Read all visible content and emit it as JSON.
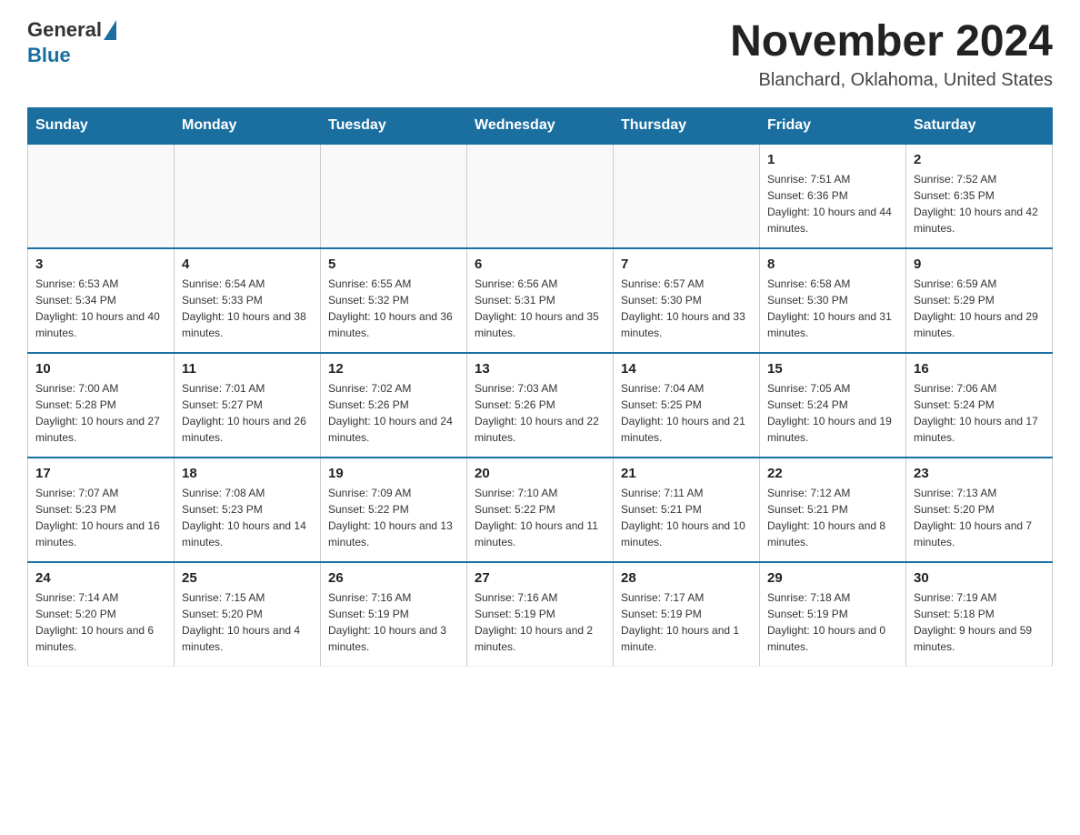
{
  "header": {
    "logo_general": "General",
    "logo_blue": "Blue",
    "title": "November 2024",
    "subtitle": "Blanchard, Oklahoma, United States"
  },
  "weekdays": [
    "Sunday",
    "Monday",
    "Tuesday",
    "Wednesday",
    "Thursday",
    "Friday",
    "Saturday"
  ],
  "weeks": [
    [
      {
        "day": "",
        "info": ""
      },
      {
        "day": "",
        "info": ""
      },
      {
        "day": "",
        "info": ""
      },
      {
        "day": "",
        "info": ""
      },
      {
        "day": "",
        "info": ""
      },
      {
        "day": "1",
        "info": "Sunrise: 7:51 AM\nSunset: 6:36 PM\nDaylight: 10 hours and 44 minutes."
      },
      {
        "day": "2",
        "info": "Sunrise: 7:52 AM\nSunset: 6:35 PM\nDaylight: 10 hours and 42 minutes."
      }
    ],
    [
      {
        "day": "3",
        "info": "Sunrise: 6:53 AM\nSunset: 5:34 PM\nDaylight: 10 hours and 40 minutes."
      },
      {
        "day": "4",
        "info": "Sunrise: 6:54 AM\nSunset: 5:33 PM\nDaylight: 10 hours and 38 minutes."
      },
      {
        "day": "5",
        "info": "Sunrise: 6:55 AM\nSunset: 5:32 PM\nDaylight: 10 hours and 36 minutes."
      },
      {
        "day": "6",
        "info": "Sunrise: 6:56 AM\nSunset: 5:31 PM\nDaylight: 10 hours and 35 minutes."
      },
      {
        "day": "7",
        "info": "Sunrise: 6:57 AM\nSunset: 5:30 PM\nDaylight: 10 hours and 33 minutes."
      },
      {
        "day": "8",
        "info": "Sunrise: 6:58 AM\nSunset: 5:30 PM\nDaylight: 10 hours and 31 minutes."
      },
      {
        "day": "9",
        "info": "Sunrise: 6:59 AM\nSunset: 5:29 PM\nDaylight: 10 hours and 29 minutes."
      }
    ],
    [
      {
        "day": "10",
        "info": "Sunrise: 7:00 AM\nSunset: 5:28 PM\nDaylight: 10 hours and 27 minutes."
      },
      {
        "day": "11",
        "info": "Sunrise: 7:01 AM\nSunset: 5:27 PM\nDaylight: 10 hours and 26 minutes."
      },
      {
        "day": "12",
        "info": "Sunrise: 7:02 AM\nSunset: 5:26 PM\nDaylight: 10 hours and 24 minutes."
      },
      {
        "day": "13",
        "info": "Sunrise: 7:03 AM\nSunset: 5:26 PM\nDaylight: 10 hours and 22 minutes."
      },
      {
        "day": "14",
        "info": "Sunrise: 7:04 AM\nSunset: 5:25 PM\nDaylight: 10 hours and 21 minutes."
      },
      {
        "day": "15",
        "info": "Sunrise: 7:05 AM\nSunset: 5:24 PM\nDaylight: 10 hours and 19 minutes."
      },
      {
        "day": "16",
        "info": "Sunrise: 7:06 AM\nSunset: 5:24 PM\nDaylight: 10 hours and 17 minutes."
      }
    ],
    [
      {
        "day": "17",
        "info": "Sunrise: 7:07 AM\nSunset: 5:23 PM\nDaylight: 10 hours and 16 minutes."
      },
      {
        "day": "18",
        "info": "Sunrise: 7:08 AM\nSunset: 5:23 PM\nDaylight: 10 hours and 14 minutes."
      },
      {
        "day": "19",
        "info": "Sunrise: 7:09 AM\nSunset: 5:22 PM\nDaylight: 10 hours and 13 minutes."
      },
      {
        "day": "20",
        "info": "Sunrise: 7:10 AM\nSunset: 5:22 PM\nDaylight: 10 hours and 11 minutes."
      },
      {
        "day": "21",
        "info": "Sunrise: 7:11 AM\nSunset: 5:21 PM\nDaylight: 10 hours and 10 minutes."
      },
      {
        "day": "22",
        "info": "Sunrise: 7:12 AM\nSunset: 5:21 PM\nDaylight: 10 hours and 8 minutes."
      },
      {
        "day": "23",
        "info": "Sunrise: 7:13 AM\nSunset: 5:20 PM\nDaylight: 10 hours and 7 minutes."
      }
    ],
    [
      {
        "day": "24",
        "info": "Sunrise: 7:14 AM\nSunset: 5:20 PM\nDaylight: 10 hours and 6 minutes."
      },
      {
        "day": "25",
        "info": "Sunrise: 7:15 AM\nSunset: 5:20 PM\nDaylight: 10 hours and 4 minutes."
      },
      {
        "day": "26",
        "info": "Sunrise: 7:16 AM\nSunset: 5:19 PM\nDaylight: 10 hours and 3 minutes."
      },
      {
        "day": "27",
        "info": "Sunrise: 7:16 AM\nSunset: 5:19 PM\nDaylight: 10 hours and 2 minutes."
      },
      {
        "day": "28",
        "info": "Sunrise: 7:17 AM\nSunset: 5:19 PM\nDaylight: 10 hours and 1 minute."
      },
      {
        "day": "29",
        "info": "Sunrise: 7:18 AM\nSunset: 5:19 PM\nDaylight: 10 hours and 0 minutes."
      },
      {
        "day": "30",
        "info": "Sunrise: 7:19 AM\nSunset: 5:18 PM\nDaylight: 9 hours and 59 minutes."
      }
    ]
  ]
}
